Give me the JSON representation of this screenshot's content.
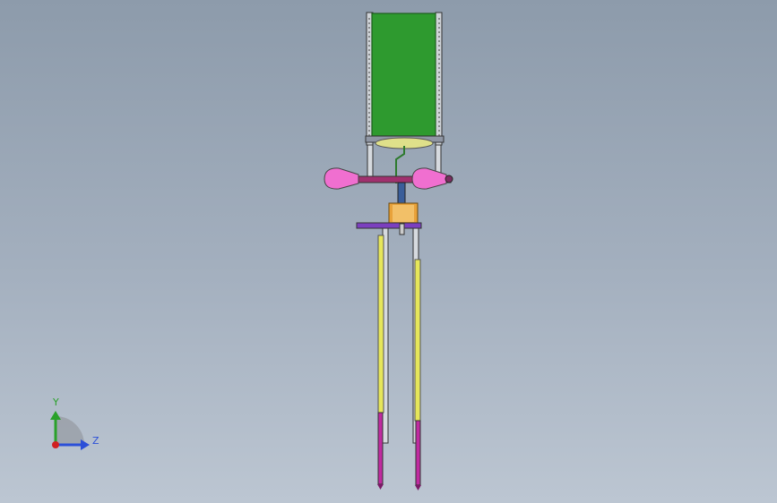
{
  "viewport": {
    "background_top": "#8d9bab",
    "background_bottom": "#bcc6d2"
  },
  "model": {
    "parts": {
      "panel": "green-panel",
      "frame": "side-frame-rails",
      "crossbar": "pink-crossbar",
      "cones": "pink-cone-weights",
      "motor": "orange-motor",
      "plate": "purple-mount-plate",
      "rods": "yellow-rods",
      "legs": "magenta-legs"
    },
    "colors": {
      "panel": "#2e9a2f",
      "frame": "#d9dde2",
      "crossbar": "#a0306e",
      "cone": "#f06fd0",
      "motor": "#e8a23a",
      "plate": "#7b3fbf",
      "rod": "#e6e65a",
      "leg": "#c02aa0"
    }
  },
  "triad": {
    "y_label": "Y",
    "z_label": "Z",
    "colors": {
      "y": "#2aa12a",
      "z": "#2b4fd8",
      "x": "#d02020"
    }
  }
}
